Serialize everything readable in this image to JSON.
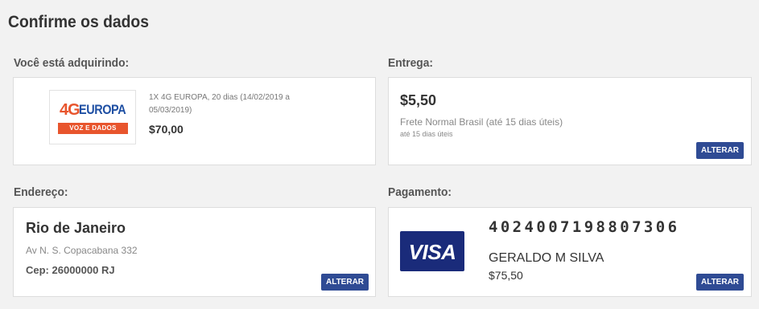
{
  "page": {
    "title": "Confirme os dados"
  },
  "product": {
    "section_label": "Você está adquirindo:",
    "logo": {
      "top_text": "4G",
      "brand_text": "EUROPA",
      "band_text": "VOZ E DADOS"
    },
    "description": "1X 4G EUROPA, 20 dias (14/02/2019 a 05/03/2019)",
    "price": "$70,00"
  },
  "delivery": {
    "section_label": "Entrega:",
    "price": "$5,50",
    "method": "Frete Normal Brasil (até 15 dias úteis)",
    "note": "até 15 dias úteis",
    "button_label": "ALTERAR"
  },
  "address": {
    "section_label": "Endereço:",
    "city": "Rio de Janeiro",
    "street": "Av N. S. Copacabana 332",
    "cep": "Cep: 26000000 RJ",
    "button_label": "ALTERAR"
  },
  "payment": {
    "section_label": "Pagamento:",
    "card_brand": "VISA",
    "card_number": "4024007198807306",
    "holder": "GERALDO M SILVA",
    "amount": "$75,50",
    "button_label": "ALTERAR"
  },
  "colors": {
    "background": "#f2f2f2",
    "button": "#2f4b94",
    "visa_blue": "#1a2b7a",
    "logo_orange": "#e8552d",
    "logo_blue": "#1e4fa3"
  }
}
